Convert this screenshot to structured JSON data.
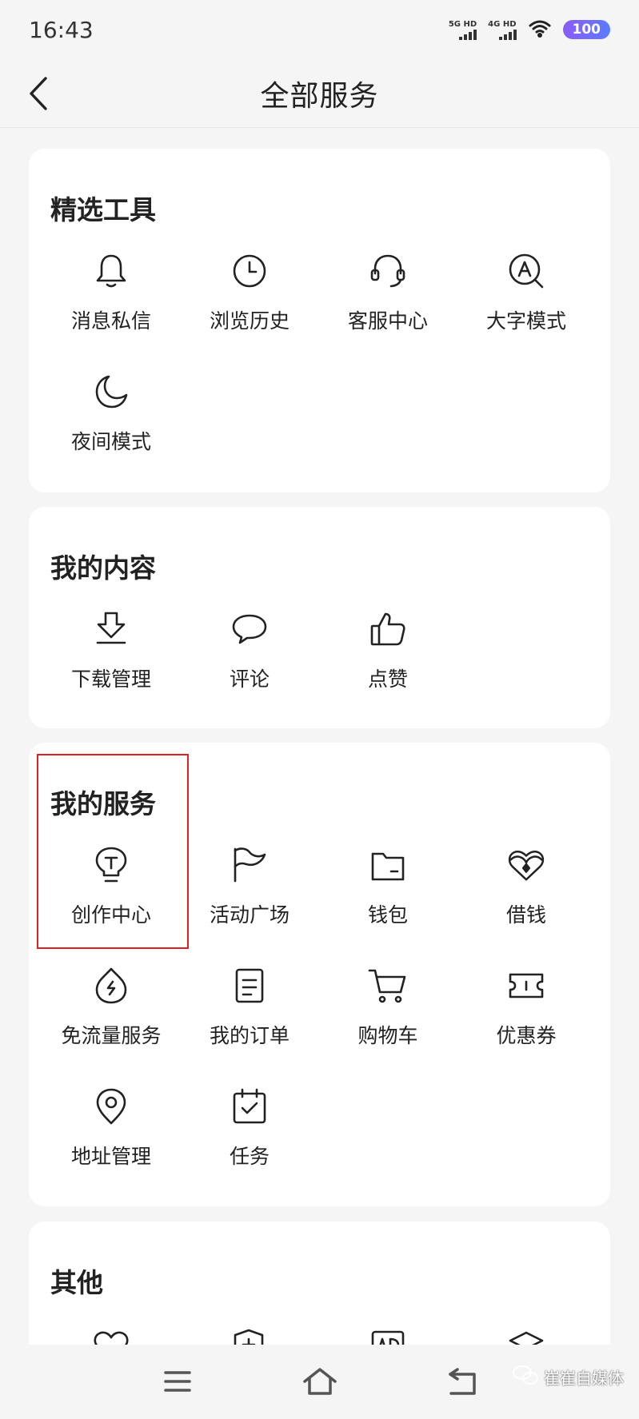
{
  "status_bar": {
    "time": "16:43",
    "signal1_label": "5G HD",
    "signal2_label": "4G HD",
    "battery": "100"
  },
  "header": {
    "title": "全部服务"
  },
  "sections": {
    "tools": {
      "title": "精选工具",
      "items": [
        {
          "label": "消息私信",
          "icon": "bell-icon"
        },
        {
          "label": "浏览历史",
          "icon": "clock-icon"
        },
        {
          "label": "客服中心",
          "icon": "headset-icon"
        },
        {
          "label": "大字模式",
          "icon": "large-font-icon"
        },
        {
          "label": "夜间模式",
          "icon": "moon-icon"
        }
      ]
    },
    "content": {
      "title": "我的内容",
      "items": [
        {
          "label": "下载管理",
          "icon": "download-icon"
        },
        {
          "label": "评论",
          "icon": "comment-icon"
        },
        {
          "label": "点赞",
          "icon": "thumbs-up-icon"
        }
      ]
    },
    "services": {
      "title": "我的服务",
      "items": [
        {
          "label": "创作中心",
          "icon": "lightbulb-icon"
        },
        {
          "label": "活动广场",
          "icon": "flag-icon"
        },
        {
          "label": "钱包",
          "icon": "wallet-icon"
        },
        {
          "label": "借钱",
          "icon": "loan-icon"
        },
        {
          "label": "免流量服务",
          "icon": "data-free-icon"
        },
        {
          "label": "我的订单",
          "icon": "order-icon"
        },
        {
          "label": "购物车",
          "icon": "cart-icon"
        },
        {
          "label": "优惠券",
          "icon": "coupon-icon"
        },
        {
          "label": "地址管理",
          "icon": "location-icon"
        },
        {
          "label": "任务",
          "icon": "task-icon"
        }
      ]
    },
    "other": {
      "title": "其他"
    }
  },
  "watermark": "崔崔自媒体",
  "colors": {
    "highlight": "#e02020",
    "battery_gradient_start": "#8a5cf6",
    "battery_gradient_end": "#5b7cff"
  }
}
